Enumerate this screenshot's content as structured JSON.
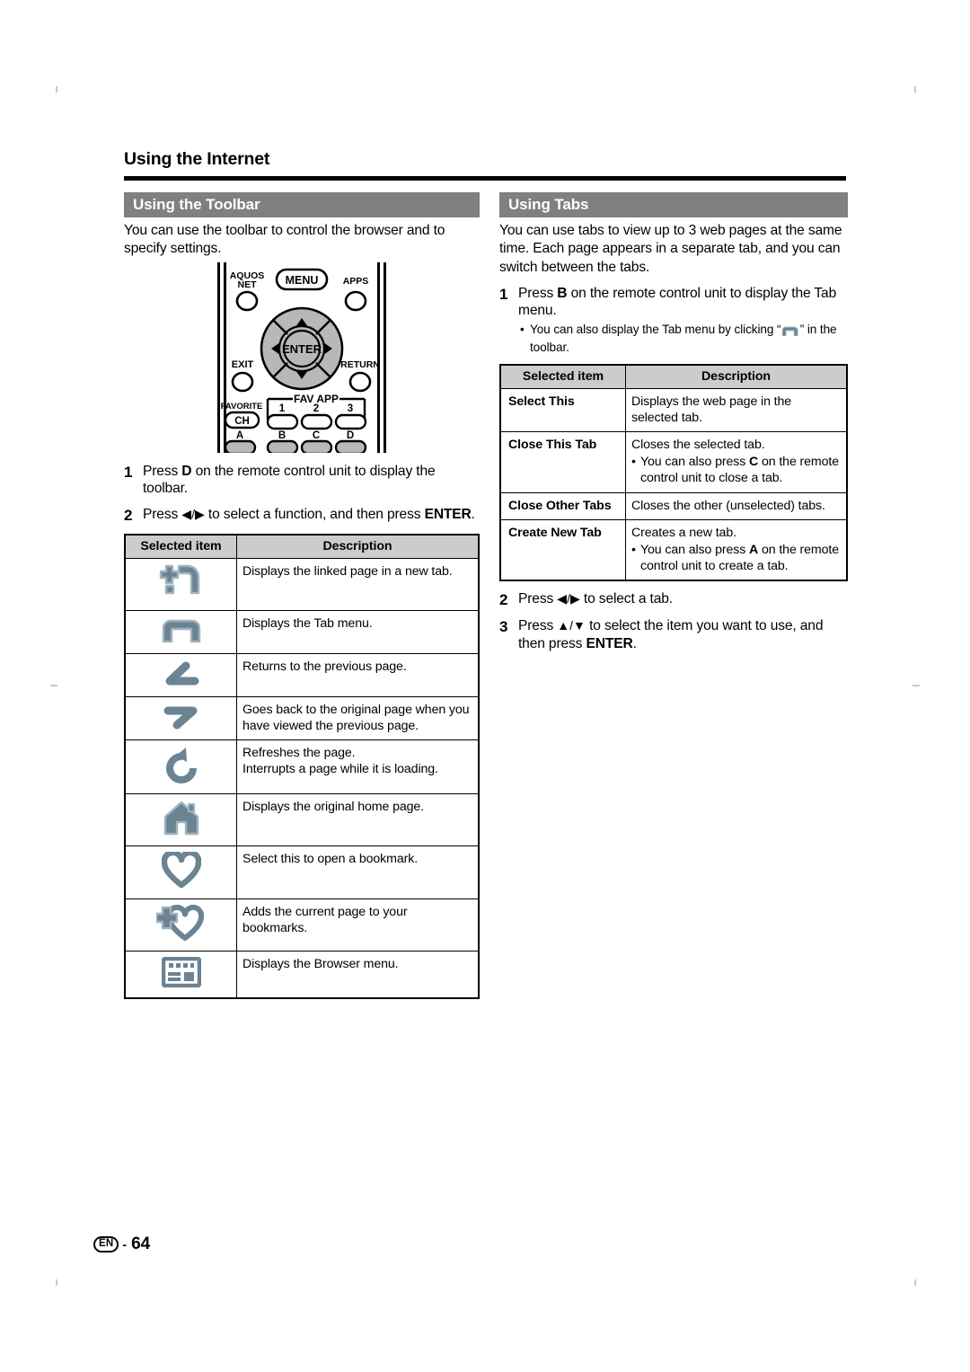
{
  "document": {
    "chapter_title": "Using the Internet",
    "footer": {
      "language_badge": "EN",
      "separator": "-",
      "page_number": "64"
    }
  },
  "left_column": {
    "section": {
      "title": "Using the Toolbar"
    },
    "intro": "You can use the toolbar to control the browser and to specify settings.",
    "remote_diagram": {
      "name": "remote-control-unit",
      "labels": {
        "aquos_net": "AQUOS\nNET",
        "aquos_net_line1": "AQUOS",
        "aquos_net_line2": "NET",
        "menu": "MENU",
        "apps": "APPS",
        "enter": "ENTER",
        "exit": "EXIT",
        "return": "RETURN",
        "favorite": "FAVORITE",
        "ch": "CH",
        "fav_app": "FAV APP",
        "fav_1": "1",
        "fav_2": "2",
        "fav_3": "3",
        "color_a": "A",
        "color_b": "B",
        "color_c": "C",
        "color_d": "D"
      }
    },
    "steps": [
      {
        "num": "1",
        "parts": [
          {
            "t": "Press "
          },
          {
            "t": "D",
            "b": true
          },
          {
            "t": " on the remote control unit to display the toolbar."
          }
        ]
      },
      {
        "num": "2",
        "parts": [
          {
            "t": "Press "
          },
          {
            "t": "◀/▶",
            "arrow": true
          },
          {
            "t": " to select a function, and then press "
          },
          {
            "t": "ENTER",
            "b": true
          },
          {
            "t": "."
          }
        ]
      }
    ],
    "table": {
      "headers": [
        "Selected item",
        "Description"
      ],
      "rows": [
        {
          "icon": "new-tab-icon",
          "description": "Displays the linked page in a new tab."
        },
        {
          "icon": "tab-menu-icon",
          "description": "Displays the Tab menu."
        },
        {
          "icon": "back-arrow-icon",
          "description": "Returns to the previous page."
        },
        {
          "icon": "forward-arrow-icon",
          "description": "Goes back to the original page when you have viewed the previous page."
        },
        {
          "icon": "refresh-icon",
          "description": "Refreshes the page.\nInterrupts a page while it is loading."
        },
        {
          "icon": "home-icon",
          "description": "Displays the original home page."
        },
        {
          "icon": "bookmark-heart-icon",
          "description": "Select this to open a bookmark."
        },
        {
          "icon": "add-bookmark-icon",
          "description": "Adds the current page to your bookmarks."
        },
        {
          "icon": "browser-menu-icon",
          "description": "Displays the Browser menu."
        }
      ]
    }
  },
  "right_column": {
    "section": {
      "title": "Using Tabs"
    },
    "intro": "You can use tabs to view up to 3 web pages at the same time. Each page appears in a separate tab, and you can switch between the tabs.",
    "steps": [
      {
        "num": "1",
        "parts": [
          {
            "t": "Press "
          },
          {
            "t": "B",
            "b": true
          },
          {
            "t": " on the remote control unit to display the Tab menu."
          }
        ],
        "bullets": [
          {
            "parts": [
              {
                "t": "You can also display the Tab menu by clicking “"
              },
              {
                "t": "",
                "icon": "tab-menu-icon"
              },
              {
                "t": "” in the toolbar."
              }
            ]
          }
        ]
      },
      {
        "num": "2",
        "parts": [
          {
            "t": "Press "
          },
          {
            "t": "◀/▶",
            "arrow": true
          },
          {
            "t": " to select a tab."
          }
        ]
      },
      {
        "num": "3",
        "parts": [
          {
            "t": "Press "
          },
          {
            "t": "▲/▼",
            "arrow": true
          },
          {
            "t": " to select the item you want to use, and then press "
          },
          {
            "t": "ENTER",
            "b": true
          },
          {
            "t": "."
          }
        ]
      }
    ],
    "table": {
      "headers": [
        "Selected item",
        "Description"
      ],
      "rows": [
        {
          "term": "Select This",
          "description": "Displays the web page in the selected tab.",
          "bullets": []
        },
        {
          "term": "Close This Tab",
          "description": "Closes the selected tab.",
          "bullets": [
            {
              "parts": [
                {
                  "t": "You can also press "
                },
                {
                  "t": "C",
                  "b": true
                },
                {
                  "t": " on the remote control unit to close a tab."
                }
              ]
            }
          ]
        },
        {
          "term": "Close Other Tabs",
          "description": "Closes the other (unselected) tabs.",
          "bullets": []
        },
        {
          "term": "Create New Tab",
          "description": "Creates a new tab.",
          "bullets": [
            {
              "parts": [
                {
                  "t": "You can also press "
                },
                {
                  "t": "A",
                  "b": true
                },
                {
                  "t": " on the remote control unit to create a tab."
                }
              ]
            }
          ]
        }
      ]
    }
  },
  "colors": {
    "section_bar": "#808080",
    "table_header": "#cccccc",
    "icon": "#6b8393",
    "icon_outline": "#9fb3bf",
    "rule": "#000000"
  }
}
